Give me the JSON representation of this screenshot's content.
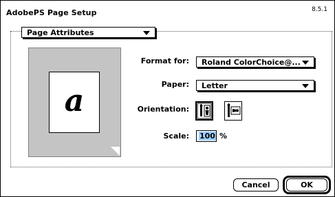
{
  "window": {
    "title": "AdobePS Page Setup",
    "version": "8.5.1"
  },
  "section_popup": {
    "value": "Page Attributes"
  },
  "preview": {
    "glyph": "a"
  },
  "format": {
    "label": "Format for:",
    "value": "Roland ColorChoice@..."
  },
  "paper": {
    "label": "Paper:",
    "value": "Letter"
  },
  "orientation": {
    "label": "Orientation:",
    "selected": "portrait"
  },
  "scale": {
    "label": "Scale:",
    "value": "100",
    "unit": "%"
  },
  "buttons": {
    "cancel": "Cancel",
    "ok": "OK"
  },
  "icons": [
    "chevron-down-icon",
    "portrait-orientation-icon",
    "landscape-orientation-icon"
  ],
  "colors": {
    "selection": "#9fd0ff",
    "preview_bg": "#c4c4c4"
  }
}
